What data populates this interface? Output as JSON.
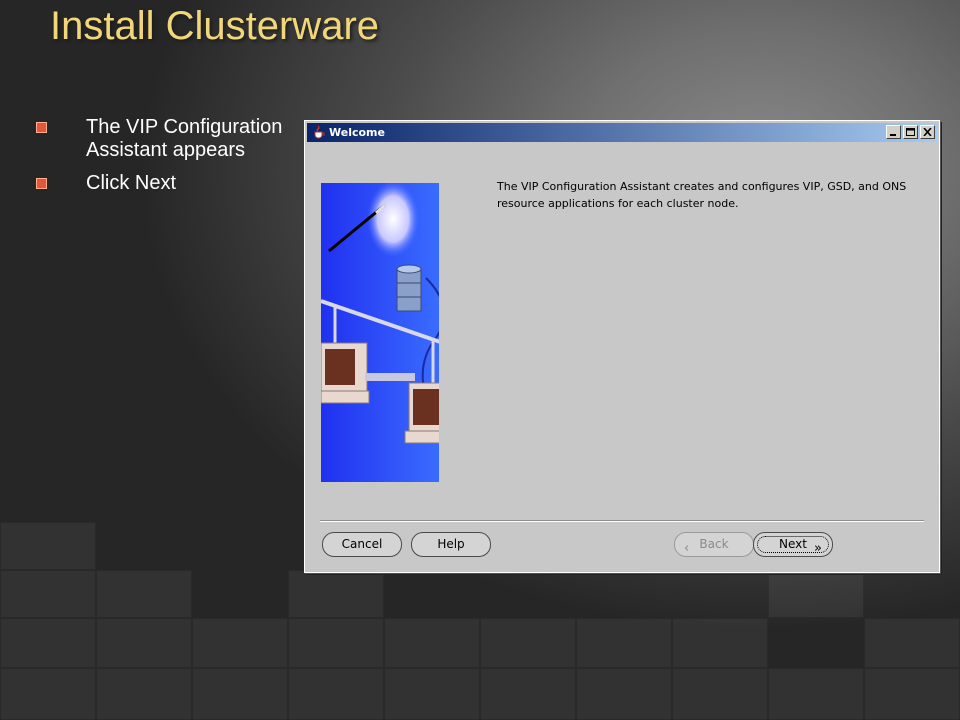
{
  "slide": {
    "title": "Install Clusterware",
    "bullets": [
      "The VIP Configuration Assistant appears",
      "Click Next"
    ]
  },
  "dialog": {
    "title": "Welcome",
    "description": "The VIP Configuration Assistant creates and configures VIP, GSD, and ONS resource applications for each cluster node.",
    "buttons": {
      "cancel": "Cancel",
      "help": "Help",
      "back": "Back",
      "next": "Next"
    },
    "back_enabled": false
  },
  "colors": {
    "title": "#f2d77a",
    "bullet": "#e4573a",
    "titlebar_start": "#0a246a",
    "titlebar_end": "#a6caf0",
    "dialog_bg": "#c8c8c8"
  },
  "icons": [
    "java-cup-icon",
    "minimize-icon",
    "maximize-icon",
    "close-icon",
    "chevron-left-icon",
    "chevron-right-icon"
  ]
}
